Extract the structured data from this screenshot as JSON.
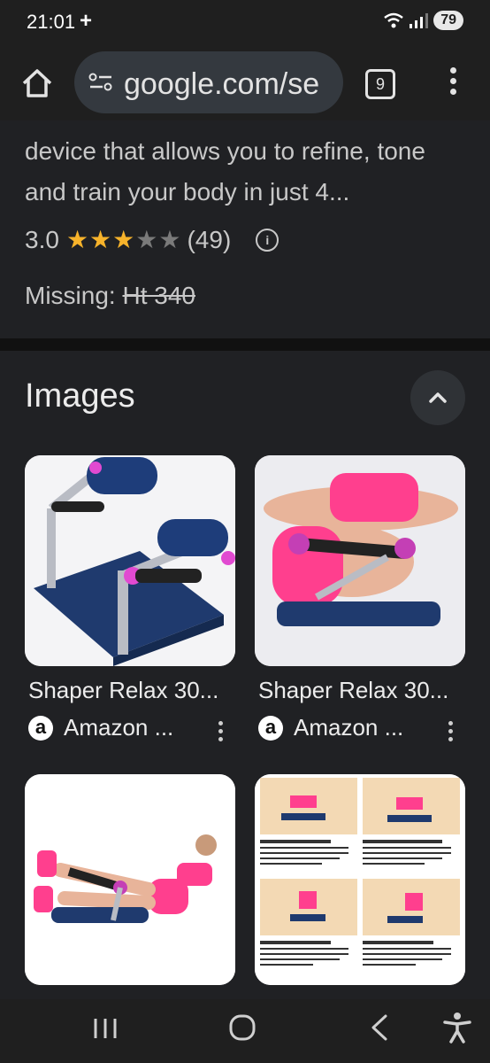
{
  "status": {
    "time": "21:01",
    "plus": "+",
    "battery": "79"
  },
  "browser": {
    "url": "google.com/se",
    "tab_count": "9"
  },
  "result": {
    "description": "device that allows you to refine, tone and train your body in just 4...",
    "rating_value": "3.0",
    "stars": {
      "value": 3,
      "max": 5
    },
    "review_count": "(49)",
    "missing_label": "Missing:",
    "missing_terms": "Ht 340"
  },
  "images": {
    "title": "Images",
    "items": [
      {
        "title": "Shaper Relax 30...",
        "source": "Amazon ..."
      },
      {
        "title": "Shaper Relax 30...",
        "source": "Amazon ..."
      },
      {
        "title": "",
        "source": ""
      },
      {
        "title": "",
        "source": ""
      }
    ],
    "source_logo_letter": "a"
  },
  "colors": {
    "star_fill": "#f7b32b",
    "star_empty": "#7a7a7a",
    "accent_pink": "#ff3f8e",
    "pad_navy": "#1f3a6e"
  }
}
